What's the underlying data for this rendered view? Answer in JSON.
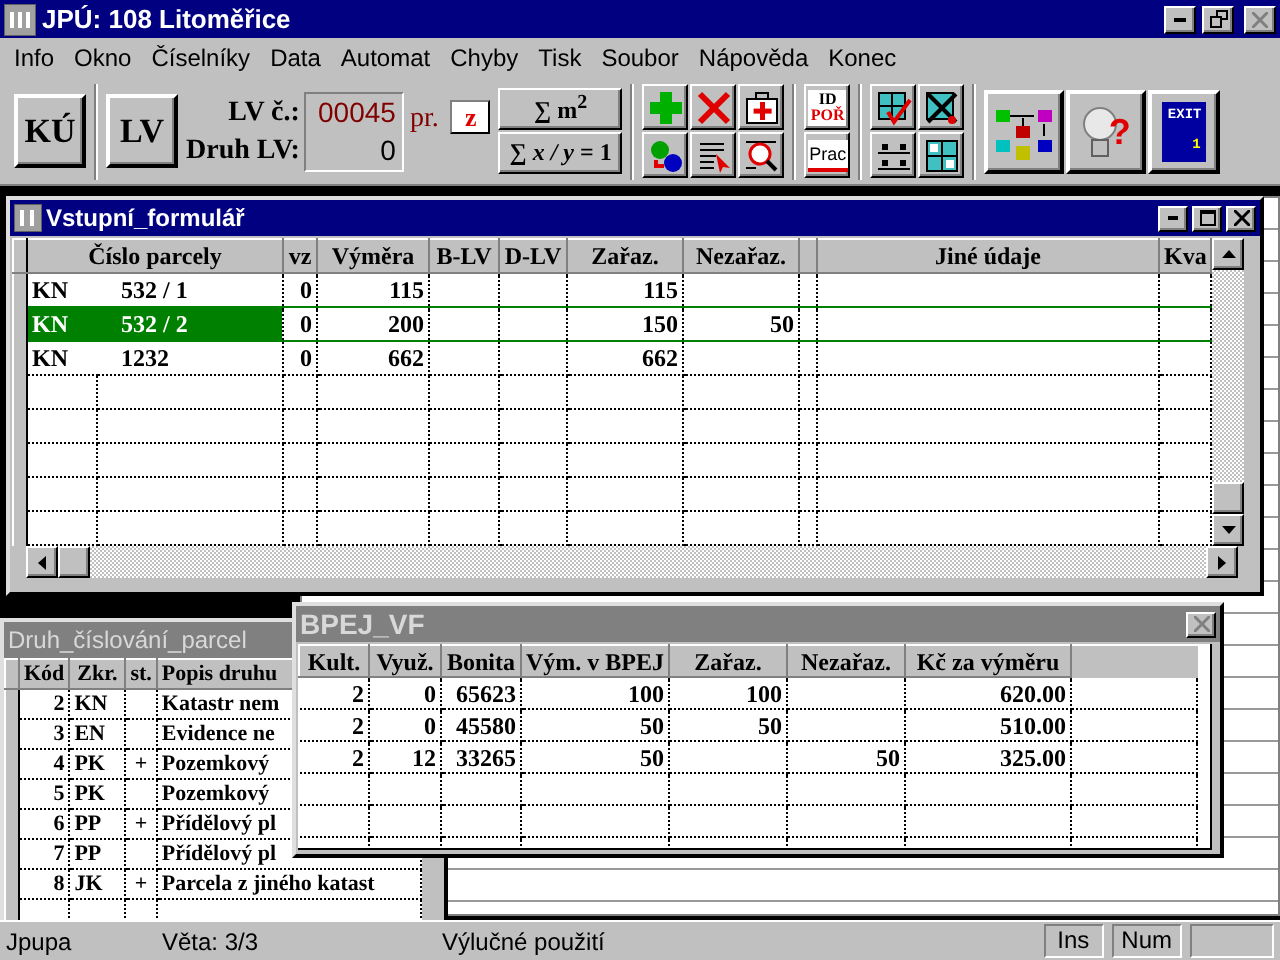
{
  "window": {
    "title": "JPÚ: 108 Litoměřice",
    "controls": [
      {
        "kind": "minimize",
        "disabled": false
      },
      {
        "kind": "restore",
        "disabled": false
      },
      {
        "kind": "close",
        "disabled": true
      }
    ]
  },
  "menu": [
    "Info",
    "Okno",
    "Číselníky",
    "Data",
    "Automat",
    "Chyby",
    "Tisk",
    "Soubor",
    "Nápověda",
    "Konec"
  ],
  "toolbar": {
    "ku_button": "KÚ",
    "lv_button": "LV",
    "lv_number_label": "LV č.:",
    "lv_number": "00045",
    "lv_suffix": "pr.",
    "lv_type_label": "Druh LV:",
    "lv_type": "0",
    "z_button": "z",
    "sum_area_button": "∑ m$^{2}$",
    "sum_ratio_button": "∑ *x / y* = 1",
    "tool_groups": [
      [
        {
          "kind": "plus"
        },
        {
          "kind": "cross"
        },
        {
          "kind": "medkit"
        },
        {
          "kind": "sort"
        },
        {
          "kind": "doc-pointer"
        },
        {
          "kind": "doc-search"
        }
      ],
      [
        {
          "kind": "id",
          "lines": [
            "ID",
            "POŘ"
          ]
        },
        {
          "kind": "prac",
          "lines": [
            "Prac"
          ]
        }
      ],
      [
        {
          "kind": "grid-check"
        },
        {
          "kind": "grid-cross"
        },
        {
          "kind": "rows"
        },
        {
          "kind": "grid"
        }
      ],
      [
        {
          "kind": "diagram"
        },
        {
          "kind": "bulb",
          "lines": [
            "?"
          ]
        },
        {
          "kind": "exit",
          "lines": [
            "EXIT",
            "1"
          ]
        }
      ]
    ]
  },
  "input_form": {
    "title": "Vstupní_formulář",
    "active": true,
    "columns": [
      {
        "kind": "text",
        "label": "Číslo parcely"
      },
      {
        "kind": "text",
        "label": "vz"
      },
      {
        "kind": "text",
        "label": "Výměra"
      },
      {
        "kind": "text",
        "label": "B-LV"
      },
      {
        "kind": "text",
        "label": "D-LV"
      },
      {
        "kind": "text",
        "label": "Zařaz."
      },
      {
        "kind": "text",
        "label": "Nezařaz."
      },
      {
        "kind": "spacer"
      },
      {
        "kind": "text",
        "label": "Jiné údaje"
      },
      {
        "kind": "text",
        "label": "Kva"
      }
    ],
    "rows": [
      {
        "selected": false,
        "cells": [
          {
            "type": "KN",
            "number": "532 / 1"
          },
          "0",
          "115",
          null,
          null,
          "115",
          null,
          null,
          null,
          null
        ]
      },
      {
        "selected": true,
        "cells": [
          {
            "type": "KN",
            "number": "532 / 2"
          },
          "0",
          "200",
          null,
          null,
          "150",
          "50",
          null,
          null,
          null
        ]
      },
      {
        "selected": false,
        "cells": [
          {
            "type": "KN",
            "number": "1232"
          },
          "0",
          "662",
          null,
          null,
          "662",
          null,
          null,
          null,
          null
        ]
      }
    ]
  },
  "parcel_numbering": {
    "title": "Druh_číslování_parcel",
    "active": false,
    "columns": [
      "Kód",
      "Zkr.",
      "st.",
      "Popis druhu"
    ],
    "rows": [
      {
        "code": "2",
        "abbr": "KN",
        "st": null,
        "description": "Katastr nem"
      },
      {
        "code": "3",
        "abbr": "EN",
        "st": null,
        "description": "Evidence ne"
      },
      {
        "code": "4",
        "abbr": "PK",
        "st": "+",
        "description": "Pozemkový"
      },
      {
        "code": "5",
        "abbr": "PK",
        "st": null,
        "description": "Pozemkový"
      },
      {
        "code": "6",
        "abbr": "PP",
        "st": "+",
        "description": "Přídělový pl"
      },
      {
        "code": "7",
        "abbr": "PP",
        "st": null,
        "description": "Přídělový pl"
      },
      {
        "code": "8",
        "abbr": "JK",
        "st": "+",
        "description": "Parcela z jiného katast"
      }
    ]
  },
  "bpej": {
    "title": "BPEJ_VF",
    "active": false,
    "columns": [
      "Kult.",
      "Využ.",
      "Bonita",
      "Vým. v BPEJ",
      "Zařaz.",
      "Nezařaz.",
      "Kč za výměru"
    ],
    "rows": [
      [
        "2",
        "0",
        "65623",
        "100",
        "100",
        null,
        "620.00"
      ],
      [
        "2",
        "0",
        "45580",
        "50",
        "50",
        null,
        "510.00"
      ],
      [
        "2",
        "12",
        "33265",
        "50",
        null,
        "50",
        "325.00"
      ]
    ]
  },
  "status_bar": {
    "panels": [
      "Jpupa",
      "Věta: 3/3",
      "Výlučné použití"
    ],
    "indicators": [
      "Ins",
      "Num"
    ]
  }
}
